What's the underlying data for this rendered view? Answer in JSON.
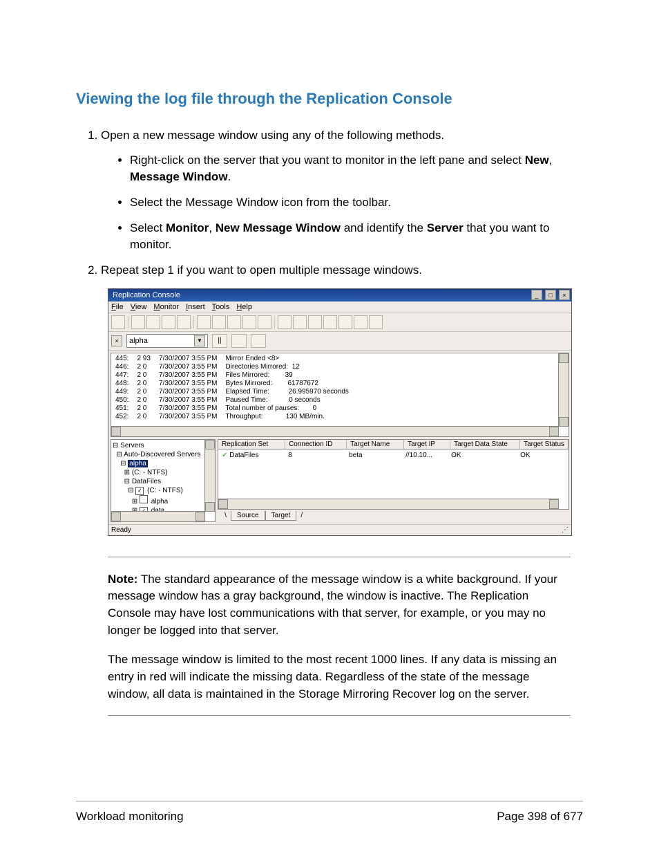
{
  "heading": "Viewing the log file through the Replication Console",
  "steps": {
    "s1": "Open a new message window using any of the following methods.",
    "b1a": "Right-click on the server that you want to monitor in the left pane and select ",
    "b1b_new": "New",
    "b1b_sep": ", ",
    "b1b_mw": "Message Window",
    "b1b_end": ".",
    "b2": "Select the Message Window icon from the toolbar.",
    "b3a": "Select ",
    "b3_mon": "Monitor",
    "b3b": ", ",
    "b3_nmw": "New Message Window",
    "b3c": " and identify the ",
    "b3_srv": "Server",
    "b3d": " that you want to monitor.",
    "s2": "Repeat step 1 if you want to open multiple message windows."
  },
  "app": {
    "title": "Replication Console",
    "win_min": "_",
    "win_max": "□",
    "win_close": "×",
    "menu": {
      "file": "File",
      "view": "View",
      "monitor": "Monitor",
      "insert": "Insert",
      "tools": "Tools",
      "help": "Help"
    },
    "filter_x": "×",
    "combo": "alpha",
    "combo_dd": "▼",
    "pause": "||",
    "log_ids": "445:\n446:\n447:\n448:\n449:\n450:\n451:\n452:",
    "log_c2": "2 93\n2 0\n2 0\n2 0\n2 0\n2 0\n2 0\n2 0",
    "log_c3": "7/30/2007 3:55 PM\n7/30/2007 3:55 PM\n7/30/2007 3:55 PM\n7/30/2007 3:55 PM\n7/30/2007 3:55 PM\n7/30/2007 3:55 PM\n7/30/2007 3:55 PM\n7/30/2007 3:55 PM",
    "log_c4": "Mirror Ended <8>\nDirectories Mirrored:  12\nFiles Mirrored:        39\nBytes Mirrored:        61787672\nElapsed Time:          26.995970 seconds\nPaused Time:           0 seconds\nTotal number of pauses:       0\nThroughput:            130 MB/min.",
    "tree": {
      "l0": "⊟ Servers",
      "l1": "  ⊟ Auto-Discovered Servers",
      "l2_pre": "    ⊟ ",
      "l2_sel": "alpha",
      "l3": "      ⊞ (C: - NTFS)",
      "l4": "      ⊟ DataFiles",
      "l5_pre": "        ⊟ ",
      "l5_ck": "✓",
      "l5_txt": " (C: - NTFS)",
      "l6_pre": "          ⊞ ",
      "l6_ck": "",
      "l6_txt": " alpha",
      "l7_pre": "          ⊞ ",
      "l7_ck": "✓",
      "l7_txt": " data"
    },
    "rtable": {
      "h1": "Replication Set",
      "h2": "Connection ID",
      "h3": "Target Name",
      "h4": "Target IP",
      "h5": "Target Data State",
      "h6": "Target Status",
      "r1_ck": "✓",
      "r1": "DataFiles",
      "r2": "8",
      "r3": "beta",
      "r4": "//10.10...",
      "r5": "OK",
      "r6": "OK"
    },
    "tabs": {
      "t1": "Source",
      "t2": "Target"
    },
    "status": "Ready"
  },
  "note": {
    "label": "Note:",
    "p1": " The standard appearance of the message window is a white background. If your message window has a gray background, the window is inactive. The Replication Console may have lost communications with that server, for example, or you may no longer be logged into that server.",
    "p2": "The message window is limited to the most recent 1000 lines. If any data is missing an entry in red will indicate the missing data. Regardless of the state of the message window, all data is maintained in the Storage Mirroring Recover log on the server."
  },
  "footer": {
    "left": "Workload monitoring",
    "right": "Page 398 of 677"
  }
}
